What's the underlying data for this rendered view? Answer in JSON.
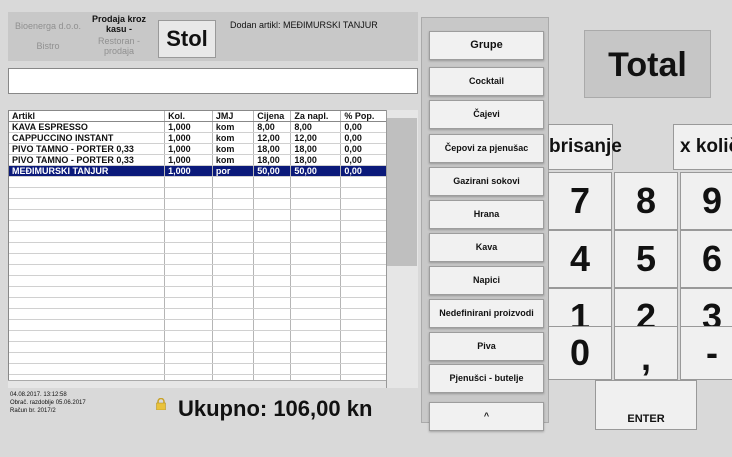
{
  "header": {
    "company": "Bioenerga d.o.o.",
    "mode_lines": [
      "Prodaja kroz",
      "kasu -"
    ],
    "location": "Bistro",
    "restaurant_lines": [
      "Restoran -",
      "prodaja"
    ],
    "stol_label": "Stol",
    "status_text": "Dodan artikl: MEĐIMURSKI TANJUR"
  },
  "table": {
    "columns": [
      "Artikl",
      "Kol.",
      "JMJ",
      "Cijena",
      "Za napl.",
      "% Pop."
    ],
    "rows": [
      [
        "KAVA ESPRESSO",
        "1,000",
        "kom",
        "8,00",
        "8,00",
        "0,00"
      ],
      [
        "CAPPUCCINO INSTANT",
        "1,000",
        "kom",
        "12,00",
        "12,00",
        "0,00"
      ],
      [
        "PIVO TAMNO - PORTER 0,33",
        "1,000",
        "kom",
        "18,00",
        "18,00",
        "0,00"
      ],
      [
        "PIVO TAMNO - PORTER 0,33",
        "1,000",
        "kom",
        "18,00",
        "18,00",
        "0,00"
      ],
      [
        "MEĐIMURSKI TANJUR",
        "1,000",
        "por",
        "50,00",
        "50,00",
        "0,00"
      ]
    ],
    "selected_row": 4
  },
  "footer": {
    "datetime": "04.08.2017.  13:12:58",
    "period": "Obrač. razdoblje 05.06.2017",
    "receipt": "Račun br. 2017/2",
    "total_text": "Ukupno: 106,00 kn"
  },
  "categories": {
    "groups_label": "Grupe",
    "items": [
      "Cocktail",
      "Čajevi",
      "Čepovi za pjenušac",
      "Gazirani sokovi",
      "Hrana",
      "Kava",
      "Napici",
      "Nedefinirani proizvodi",
      "Piva",
      "Pjenušci - butelje"
    ],
    "up_label": "^"
  },
  "keypad": {
    "total_label": "Total",
    "delete_label": "brisanje",
    "qty_label": "x količina",
    "keys": [
      "7",
      "8",
      "9",
      "4",
      "5",
      "6",
      "1",
      "2",
      "3",
      "0",
      ",",
      "-"
    ],
    "enter_label": "ENTER"
  },
  "colors": {
    "selection": "#0b1a7a",
    "background": "#d9d9d9"
  }
}
